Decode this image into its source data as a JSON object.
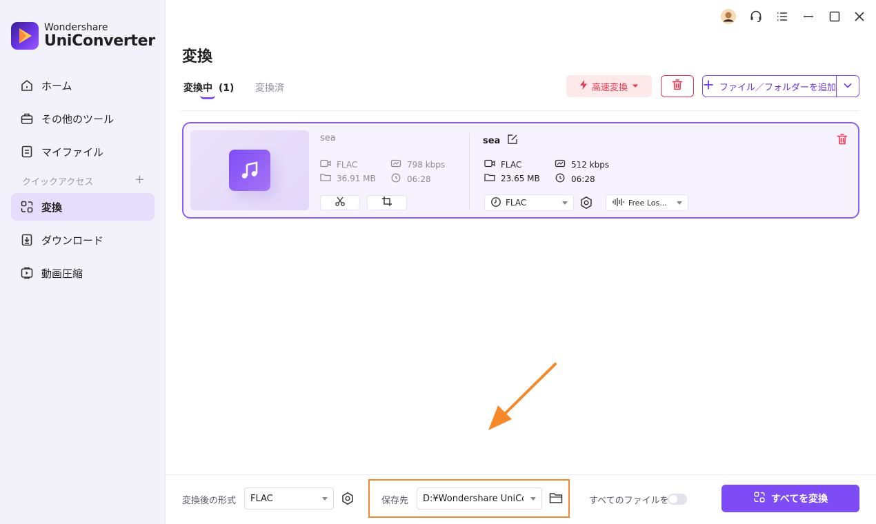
{
  "app": {
    "brand_top": "Wondershare",
    "brand_bottom": "UniConverter"
  },
  "sidebar": {
    "items": [
      {
        "label": "ホーム",
        "icon": "home-icon"
      },
      {
        "label": "その他のツール",
        "icon": "toolbox-icon"
      },
      {
        "label": "マイファイル",
        "icon": "file-icon"
      },
      {
        "label": "変換",
        "icon": "convert-icon",
        "active": true
      },
      {
        "label": "ダウンロード",
        "icon": "download-icon"
      },
      {
        "label": "動画圧縮",
        "icon": "compress-icon"
      }
    ],
    "quick_access": "クイックアクセス",
    "quick_add": "+"
  },
  "main": {
    "title": "変換",
    "tabs": [
      {
        "label": "変換中",
        "count": "(1)",
        "active": true
      },
      {
        "label": "変換済",
        "active": false
      }
    ],
    "fast_convert_label": "高速変換",
    "add_files_label": "ファイル／フォルダーを追加"
  },
  "file_card": {
    "source": {
      "name": "sea",
      "format": "FLAC",
      "size": "36.91 MB",
      "bitrate": "798 kbps",
      "duration": "06:28"
    },
    "output": {
      "name": "sea",
      "format": "FLAC",
      "size": "23.65 MB",
      "bitrate": "512 kbps",
      "duration": "06:28",
      "format_select": "FLAC",
      "audio_select": "Free Los..."
    }
  },
  "bottom_bar": {
    "output_format_label": "変換後の形式",
    "output_format_value": "FLAC",
    "save_to_label": "保存先",
    "save_to_value": "D:¥Wondershare UniConv",
    "merge_label": "すべてのファイルを...",
    "merge_toggle": false,
    "convert_all_label": "すべてを変換"
  },
  "colors": {
    "accent": "#7d4cf5",
    "danger": "#e8334a",
    "highlight_box": "#f5892a"
  }
}
